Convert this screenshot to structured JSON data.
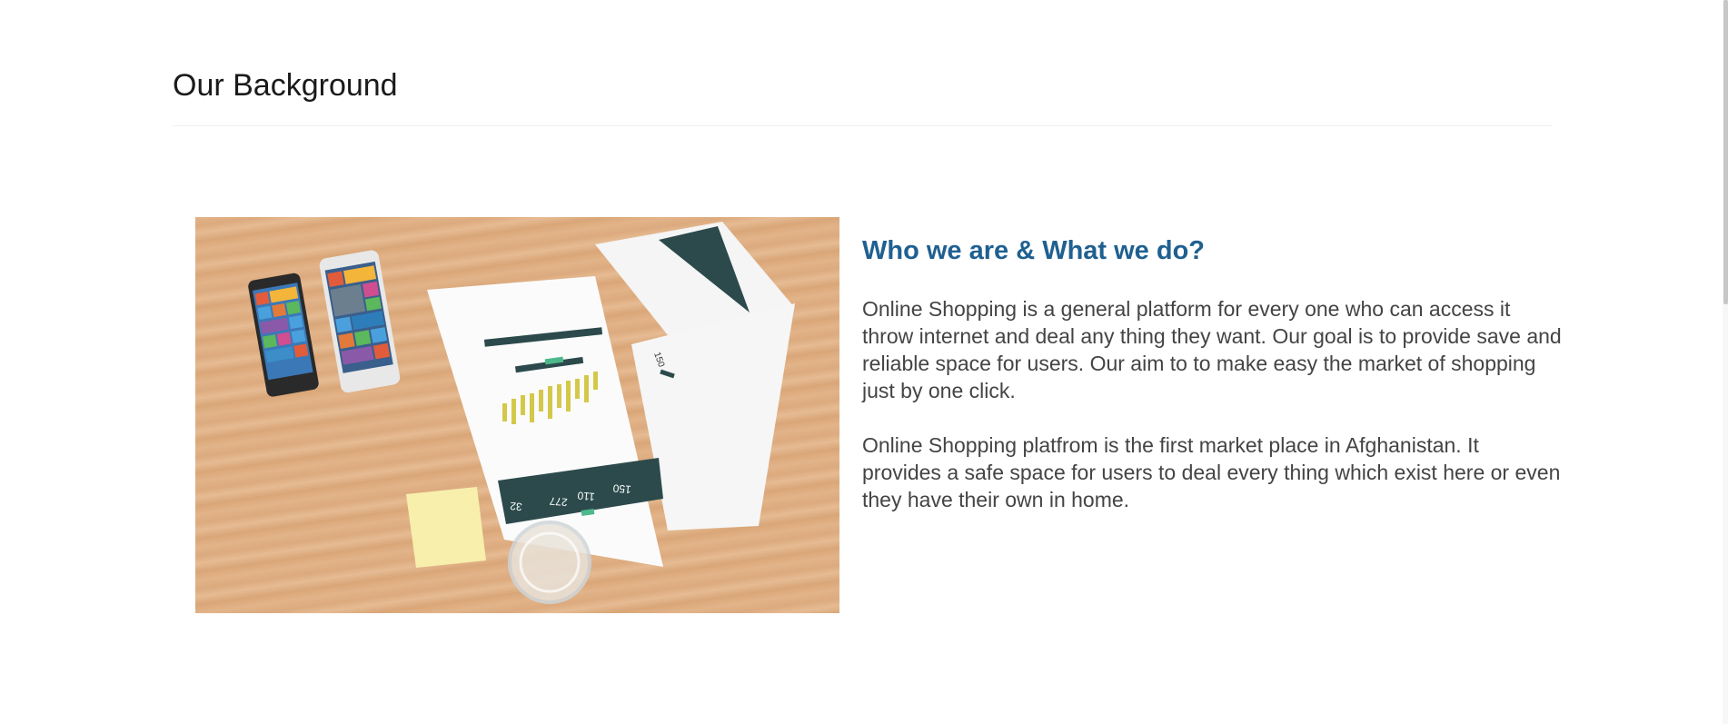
{
  "page": {
    "section_title": "Our Background"
  },
  "image": {
    "alt": "Two smartphones, printed charts, a sticky note and a glass on a wooden desk"
  },
  "content": {
    "heading": "Who we are & What we do?",
    "paragraphs": [
      "Online Shopping is a general platform for every one who can access it throw internet and deal any thing they want. Our goal is to provide save and reliable space for users. Our aim to to make easy the market of shopping just by one click.",
      "Online Shopping platfrom is the first market place in Afghanistan. It provides a safe space for users to deal every thing which exist here or even they have their own in home."
    ]
  },
  "photo_labels": {
    "stat_1": "150",
    "stat_2": "110",
    "stat_3": "277",
    "stat_4": "32",
    "corner_stat": "150"
  },
  "colors": {
    "heading_accent": "#1f6090",
    "body_text": "#444444",
    "title_text": "#1a1a1a"
  }
}
